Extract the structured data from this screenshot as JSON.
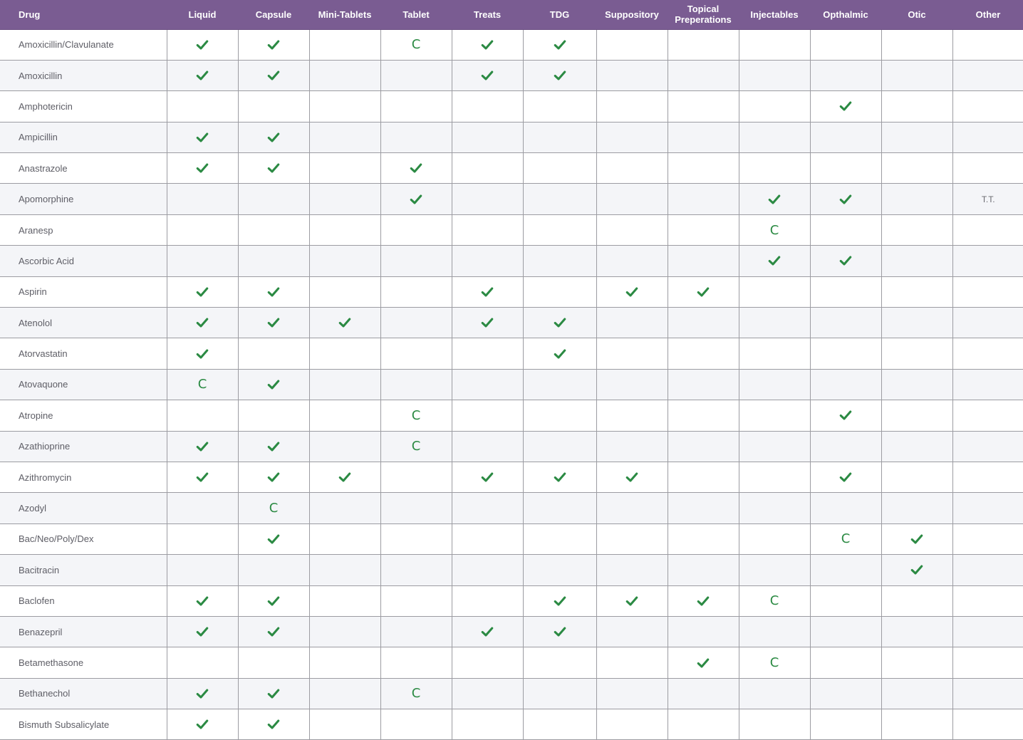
{
  "table": {
    "columns": [
      "Drug",
      "Liquid",
      "Capsule",
      "Mini-Tablets",
      "Tablet",
      "Treats",
      "TDG",
      "Suppository",
      "Topical\nPreperations",
      "Injectables",
      "Opthalmic",
      "Otic",
      "Other"
    ],
    "check_icon": "checkmark-icon",
    "check_color": "#2b8a43",
    "header_color": "#7a5c92",
    "rows": [
      {
        "drug": "Amoxicillin/Clavulanate",
        "cells": [
          "check",
          "check",
          "",
          "C",
          "check",
          "check",
          "",
          "",
          "",
          "",
          "",
          ""
        ]
      },
      {
        "drug": "Amoxicillin",
        "cells": [
          "check",
          "check",
          "",
          "",
          "check",
          "check",
          "",
          "",
          "",
          "",
          "",
          ""
        ]
      },
      {
        "drug": "Amphotericin",
        "cells": [
          "",
          "",
          "",
          "",
          "",
          "",
          "",
          "",
          "",
          "check",
          "",
          ""
        ]
      },
      {
        "drug": "Ampicillin",
        "cells": [
          "check",
          "check",
          "",
          "",
          "",
          "",
          "",
          "",
          "",
          "",
          "",
          ""
        ]
      },
      {
        "drug": "Anastrazole",
        "cells": [
          "check",
          "check",
          "",
          "check",
          "",
          "",
          "",
          "",
          "",
          "",
          "",
          ""
        ]
      },
      {
        "drug": "Apomorphine",
        "cells": [
          "",
          "",
          "",
          "check",
          "",
          "",
          "",
          "",
          "check",
          "check",
          "",
          "T.T."
        ]
      },
      {
        "drug": "Aranesp",
        "cells": [
          "",
          "",
          "",
          "",
          "",
          "",
          "",
          "",
          "C",
          "",
          "",
          ""
        ]
      },
      {
        "drug": "Ascorbic Acid",
        "cells": [
          "",
          "",
          "",
          "",
          "",
          "",
          "",
          "",
          "check",
          "check",
          "",
          ""
        ]
      },
      {
        "drug": "Aspirin",
        "cells": [
          "check",
          "check",
          "",
          "",
          "check",
          "",
          "check",
          "check",
          "",
          "",
          "",
          ""
        ]
      },
      {
        "drug": "Atenolol",
        "cells": [
          "check",
          "check",
          "check",
          "",
          "check",
          "check",
          "",
          "",
          "",
          "",
          "",
          ""
        ]
      },
      {
        "drug": "Atorvastatin",
        "cells": [
          "check",
          "",
          "",
          "",
          "",
          "check",
          "",
          "",
          "",
          "",
          "",
          ""
        ]
      },
      {
        "drug": "Atovaquone",
        "cells": [
          "C",
          "check",
          "",
          "",
          "",
          "",
          "",
          "",
          "",
          "",
          "",
          ""
        ]
      },
      {
        "drug": "Atropine",
        "cells": [
          "",
          "",
          "",
          "C",
          "",
          "",
          "",
          "",
          "",
          "check",
          "",
          ""
        ]
      },
      {
        "drug": "Azathioprine",
        "cells": [
          "check",
          "check",
          "",
          "C",
          "",
          "",
          "",
          "",
          "",
          "",
          "",
          ""
        ]
      },
      {
        "drug": "Azithromycin",
        "cells": [
          "check",
          "check",
          "check",
          "",
          "check",
          "check",
          "check",
          "",
          "",
          "check",
          "",
          ""
        ]
      },
      {
        "drug": "Azodyl",
        "cells": [
          "",
          "C",
          "",
          "",
          "",
          "",
          "",
          "",
          "",
          "",
          "",
          ""
        ]
      },
      {
        "drug": "Bac/Neo/Poly/Dex",
        "cells": [
          "",
          "check",
          "",
          "",
          "",
          "",
          "",
          "",
          "",
          "C",
          "check",
          ""
        ]
      },
      {
        "drug": "Bacitracin",
        "cells": [
          "",
          "",
          "",
          "",
          "",
          "",
          "",
          "",
          "",
          "",
          "check",
          ""
        ]
      },
      {
        "drug": "Baclofen",
        "cells": [
          "check",
          "check",
          "",
          "",
          "",
          "check",
          "check",
          "check",
          "C",
          "",
          "",
          ""
        ]
      },
      {
        "drug": "Benazepril",
        "cells": [
          "check",
          "check",
          "",
          "",
          "check",
          "check",
          "",
          "",
          "",
          "",
          "",
          ""
        ]
      },
      {
        "drug": "Betamethasone",
        "cells": [
          "",
          "",
          "",
          "",
          "",
          "",
          "",
          "check",
          "C",
          "",
          "",
          ""
        ]
      },
      {
        "drug": "Bethanechol",
        "cells": [
          "check",
          "check",
          "",
          "C",
          "",
          "",
          "",
          "",
          "",
          "",
          "",
          ""
        ]
      },
      {
        "drug": "Bismuth Subsalicylate",
        "cells": [
          "check",
          "check",
          "",
          "",
          "",
          "",
          "",
          "",
          "",
          "",
          "",
          ""
        ]
      }
    ]
  }
}
